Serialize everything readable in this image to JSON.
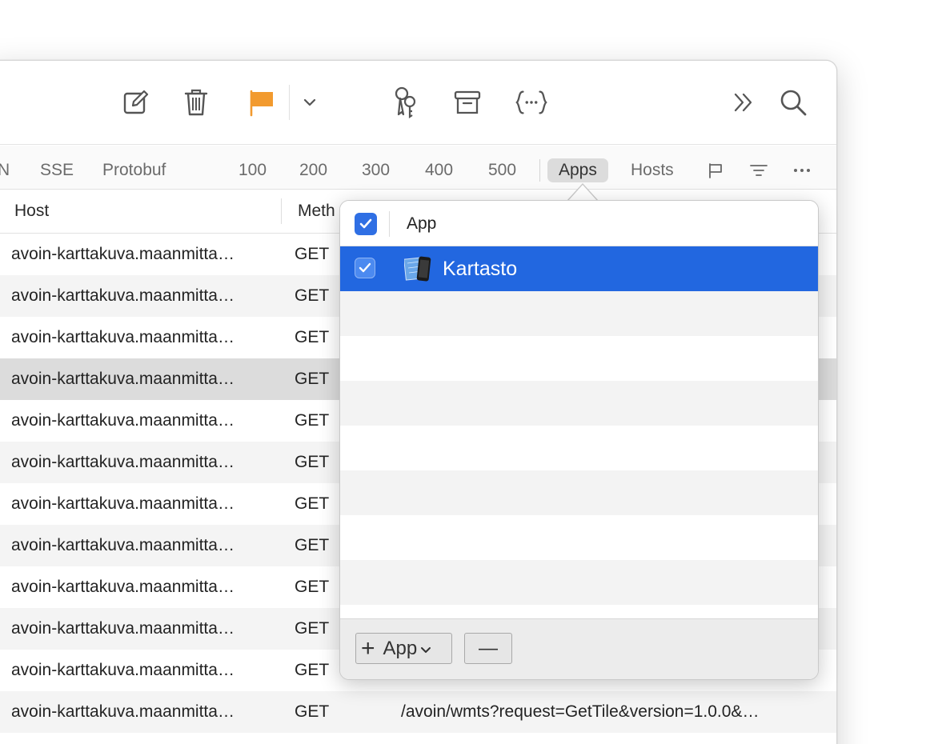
{
  "toolbar": {
    "icons": [
      "compose-icon",
      "trash-icon",
      "flag-icon",
      "chevron-down-icon",
      "keychain-icon",
      "archive-icon",
      "braces-icon",
      "double-chevron-right-icon",
      "search-icon"
    ],
    "flag_color": "#f29a2e"
  },
  "filterbar": {
    "tabs": {
      "cut": "N",
      "sse": "SSE",
      "protobuf": "Protobuf",
      "s100": "100",
      "s200": "200",
      "s300": "300",
      "s400": "400",
      "s500": "500",
      "apps": "Apps",
      "hosts": "Hosts"
    },
    "active_tab": "Apps",
    "icons": [
      "flag-outline-icon",
      "filter-lines-icon",
      "more-dots-icon"
    ]
  },
  "table": {
    "columns": {
      "host": "Host",
      "method": "Meth"
    },
    "rows": [
      {
        "host": "avoin-karttakuva.maanmitta…",
        "method": "GET",
        "path": ""
      },
      {
        "host": "avoin-karttakuva.maanmitta…",
        "method": "GET",
        "path": ""
      },
      {
        "host": "avoin-karttakuva.maanmitta…",
        "method": "GET",
        "path": ""
      },
      {
        "host": "avoin-karttakuva.maanmitta…",
        "method": "GET",
        "path": ""
      },
      {
        "host": "avoin-karttakuva.maanmitta…",
        "method": "GET",
        "path": ""
      },
      {
        "host": "avoin-karttakuva.maanmitta…",
        "method": "GET",
        "path": ""
      },
      {
        "host": "avoin-karttakuva.maanmitta…",
        "method": "GET",
        "path": ""
      },
      {
        "host": "avoin-karttakuva.maanmitta…",
        "method": "GET",
        "path": ""
      },
      {
        "host": "avoin-karttakuva.maanmitta…",
        "method": "GET",
        "path": ""
      },
      {
        "host": "avoin-karttakuva.maanmitta…",
        "method": "GET",
        "path": ""
      },
      {
        "host": "avoin-karttakuva.maanmitta…",
        "method": "GET",
        "path": ""
      },
      {
        "host": "avoin-karttakuva.maanmitta…",
        "method": "GET",
        "path": "/avoin/wmts?request=GetTile&version=1.0.0&…"
      }
    ]
  },
  "popover": {
    "header_label": "App",
    "apps": [
      {
        "name": "Kartasto",
        "checked": true,
        "selected": true
      }
    ],
    "add_button_label": "App",
    "add_button_plus": "+",
    "add_button_chevron": "⌄",
    "remove_button_label": "—"
  },
  "colors": {
    "accent": "#2f6fe4",
    "selection": "#2267e0"
  }
}
